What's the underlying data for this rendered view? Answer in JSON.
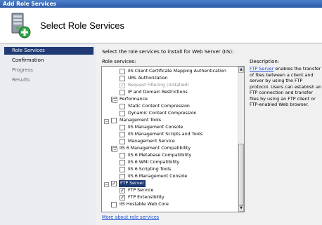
{
  "window": {
    "title": "Add Role Services"
  },
  "header": {
    "title": "Select Role Services"
  },
  "nav": {
    "items": [
      {
        "label": "Role Services",
        "state": "active"
      },
      {
        "label": "Confirmation",
        "state": "done"
      },
      {
        "label": "Progress",
        "state": "pending"
      },
      {
        "label": "Results",
        "state": "pending"
      }
    ]
  },
  "main": {
    "intro": "Select the role services to install for Web Server (IIS):",
    "role_services_label": "Role services:",
    "more_link": "More about role services"
  },
  "tree": [
    {
      "label": "IIS Client Certificate Mapping Authentication",
      "checked": false,
      "disabled": false
    },
    {
      "label": "URL Authorization",
      "checked": false,
      "disabled": false
    },
    {
      "label": "Request Filtering (Installed)",
      "checked": true,
      "disabled": true
    },
    {
      "label": "IP and Domain Restrictions",
      "checked": false,
      "disabled": false
    },
    {
      "label": "Performance",
      "checked": false,
      "disabled": false
    },
    {
      "label": "Static Content Compression",
      "checked": false,
      "disabled": false
    },
    {
      "label": "Dynamic Content Compression",
      "checked": false,
      "disabled": false
    },
    {
      "label": "Management Tools",
      "checked": false,
      "disabled": false
    },
    {
      "label": "IIS Management Console",
      "checked": false,
      "disabled": false
    },
    {
      "label": "IIS Management Scripts and Tools",
      "checked": false,
      "disabled": false
    },
    {
      "label": "Management Service",
      "checked": false,
      "disabled": false
    },
    {
      "label": "IIS 6 Management Compatibility",
      "checked": false,
      "disabled": false
    },
    {
      "label": "IIS 6 Metabase Compatibility",
      "checked": false,
      "disabled": false
    },
    {
      "label": "IIS 6 WMI Compatibility",
      "checked": false,
      "disabled": false
    },
    {
      "label": "IIS 6 Scripting Tools",
      "checked": false,
      "disabled": false
    },
    {
      "label": "IIS 6 Management Console",
      "checked": false,
      "disabled": false
    },
    {
      "label": "FTP Server",
      "checked": true,
      "disabled": false,
      "selected": true
    },
    {
      "label": "FTP Service",
      "checked": true,
      "disabled": false
    },
    {
      "label": "FTP Extensibility",
      "checked": true,
      "disabled": false
    },
    {
      "label": "IIS Hostable Web Core",
      "checked": false,
      "disabled": false
    }
  ],
  "description": {
    "label": "Description:",
    "link": "FTP Server",
    "text": " enables the transfer of files between a client and server by using the FTP protocol. Users can establish an FTP connection and transfer files by using an FTP client or FTP-enabled Web browser."
  },
  "colors": {
    "accent": "#1f3a74",
    "link": "#1b4fd1",
    "titlebar": "#2b5aa6"
  }
}
